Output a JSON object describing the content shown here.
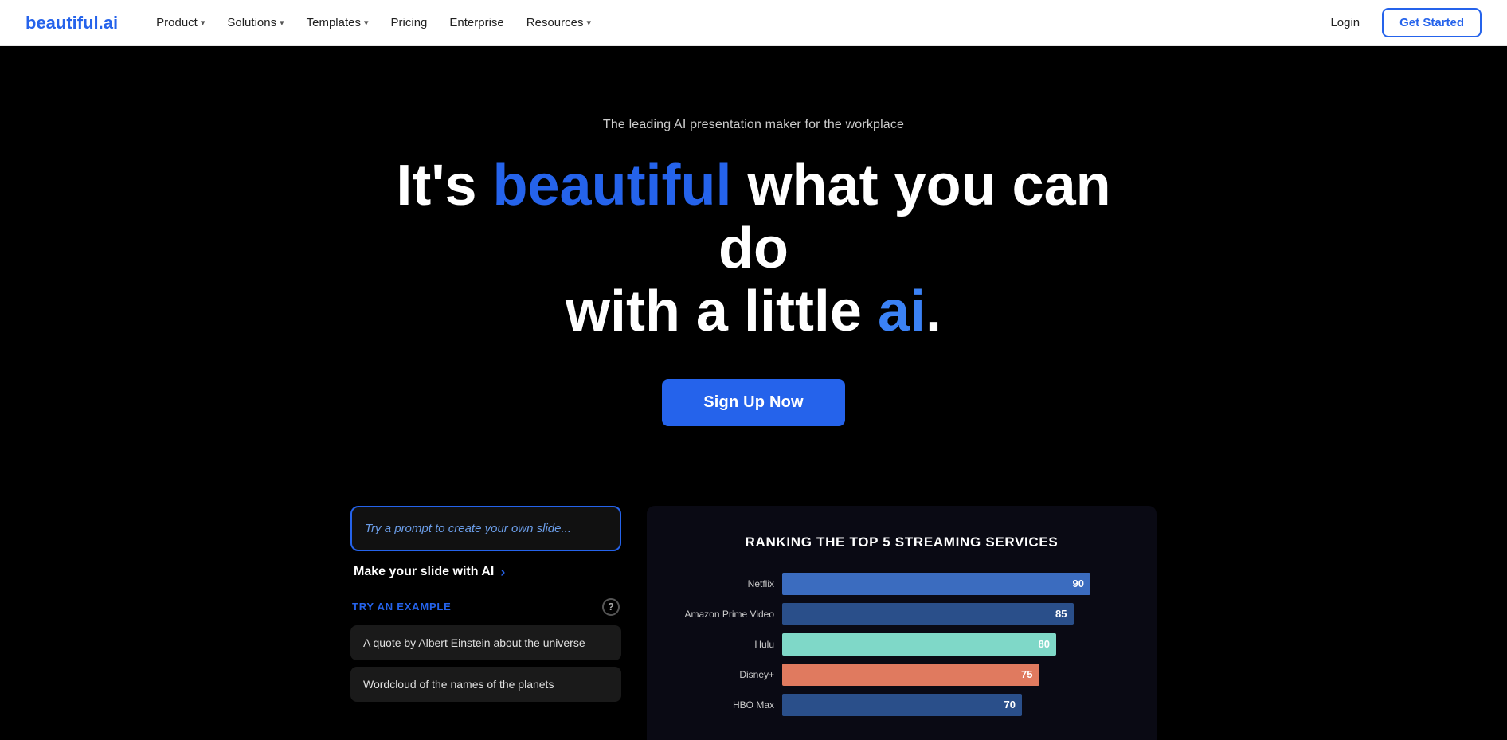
{
  "nav": {
    "logo_text": "beautiful.",
    "logo_accent": "ai",
    "items": [
      {
        "label": "Product",
        "has_dropdown": true
      },
      {
        "label": "Solutions",
        "has_dropdown": true
      },
      {
        "label": "Templates",
        "has_dropdown": true
      },
      {
        "label": "Pricing",
        "has_dropdown": false
      },
      {
        "label": "Enterprise",
        "has_dropdown": false
      },
      {
        "label": "Resources",
        "has_dropdown": true
      }
    ],
    "login_label": "Login",
    "get_started_label": "Get Started"
  },
  "hero": {
    "subtitle": "The leading AI presentation maker for the workplace",
    "headline_part1": "It's ",
    "headline_blue": "beautiful",
    "headline_part2": " what you can do",
    "headline_part3": "with a little ",
    "headline_ai": "ai",
    "headline_dot": ".",
    "cta_label": "Sign Up Now"
  },
  "interactive": {
    "prompt_placeholder": "Try a prompt to create your own slide...",
    "make_slide_label": "Make your slide with AI",
    "try_example_label": "TRY AN EXAMPLE",
    "help_icon": "?",
    "examples": [
      "A quote by Albert Einstein about the universe",
      "Wordcloud of the names of the planets"
    ]
  },
  "chart": {
    "title": "RANKING THE TOP 5 STREAMING SERVICES",
    "bars": [
      {
        "label": "Netflix",
        "value": 90,
        "color": "#3b6cbf",
        "max": 100
      },
      {
        "label": "Amazon Prime Video",
        "value": 85,
        "color": "#2a4f8a",
        "max": 100
      },
      {
        "label": "Hulu",
        "value": 80,
        "color": "#7fd8c8",
        "max": 100
      },
      {
        "label": "Disney+",
        "value": 75,
        "color": "#e07a5f",
        "max": 100
      },
      {
        "label": "HBO Max",
        "value": 70,
        "color": "#2a4f8a",
        "max": 100
      }
    ]
  }
}
